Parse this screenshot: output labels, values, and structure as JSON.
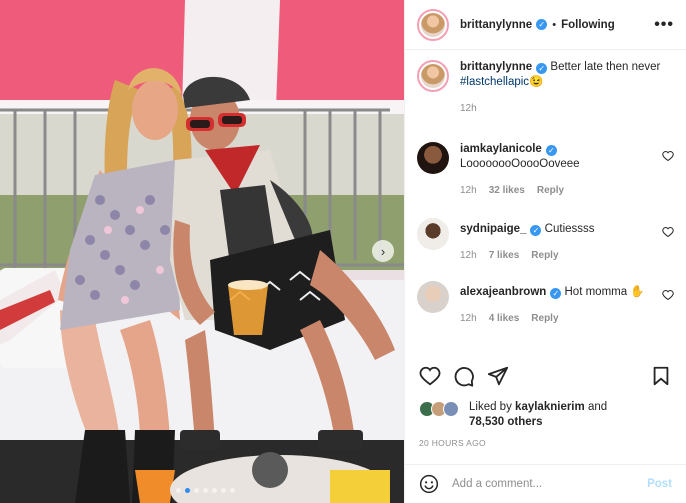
{
  "post": {
    "author": "brittanylynne",
    "follow_state": "Following",
    "separator": "•",
    "more_icon": "more-horizontal-icon",
    "carousel": {
      "slide_count": 7,
      "active_slide": 1,
      "next_icon": "chevron-right-icon"
    }
  },
  "caption": {
    "username": "brittanylynne",
    "text": "Better late then never",
    "hashtag": "#lastchellapic",
    "emoji": "😉",
    "time": "12h"
  },
  "comments": [
    {
      "username": "iamkaylanicole",
      "text": "LoooooooOoooOoveee",
      "time": "12h",
      "likes": "32 likes",
      "reply": "Reply"
    },
    {
      "username": "sydnipaige_",
      "text": "Cutiessss",
      "time": "12h",
      "likes": "7 likes",
      "reply": "Reply"
    },
    {
      "username": "alexajeanbrown",
      "text": "Hot momma ✋",
      "time": "12h",
      "likes": "4 likes",
      "reply": "Reply"
    }
  ],
  "likes": {
    "prefix": "Liked by",
    "user": "kaylaknierim",
    "and": "and",
    "others": "78,530 others"
  },
  "posted_ago": "20 HOURS AGO",
  "add_comment": {
    "placeholder": "Add a comment...",
    "post_label": "Post"
  },
  "colors": {
    "verified": "#3897f0",
    "link": "#00376b",
    "post_disabled": "#b2dffc",
    "muted": "#8e8e8e"
  }
}
